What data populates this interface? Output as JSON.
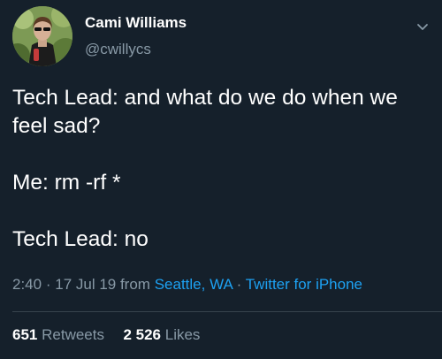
{
  "author": {
    "display_name": "Cami Williams",
    "handle": "@cwillycs"
  },
  "tweet": {
    "lines": [
      "Tech Lead: and what do we do when we feel sad?",
      "Me: rm -rf *",
      "Tech Lead: no"
    ]
  },
  "meta": {
    "time": "2:40",
    "separator": "·",
    "date": "17 Jul 19 from",
    "location": "Seattle, WA",
    "source": "Twitter for iPhone"
  },
  "stats": {
    "retweets_count": "651",
    "retweets_label": "Retweets",
    "likes_count": "2 526",
    "likes_label": "Likes"
  },
  "icons": {
    "menu": "chevron-down-icon"
  },
  "colors": {
    "background": "#15202b",
    "secondary_text": "#8899a6",
    "link": "#1da1f2",
    "divider": "#38444d"
  }
}
